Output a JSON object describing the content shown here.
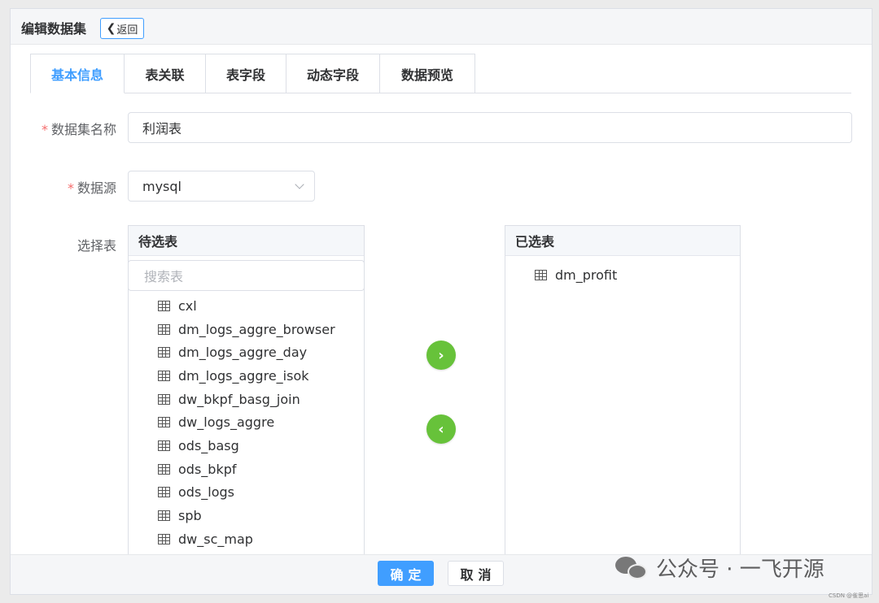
{
  "header": {
    "title": "编辑数据集",
    "back_label": "返回"
  },
  "tabs": [
    {
      "label": "基本信息",
      "active": true
    },
    {
      "label": "表关联"
    },
    {
      "label": "表字段"
    },
    {
      "label": "动态字段"
    },
    {
      "label": "数据预览"
    }
  ],
  "form": {
    "name_label": "数据集名称",
    "name_value": "利润表",
    "source_label": "数据源",
    "source_value": "mysql",
    "select_label": "选择表",
    "required_mark": "*"
  },
  "candidate_panel": {
    "title": "待选表",
    "search_placeholder": "搜索表",
    "items": [
      "cxl",
      "dm_logs_aggre_browser",
      "dm_logs_aggre_day",
      "dm_logs_aggre_isok",
      "dw_bkpf_basg_join",
      "dw_logs_aggre",
      "ods_basg",
      "ods_bkpf",
      "ods_logs",
      "spb",
      "dw_sc_map"
    ]
  },
  "selected_panel": {
    "title": "已选表",
    "items": [
      "dm_profit"
    ]
  },
  "transfer": {
    "to_right_glyph": "›",
    "to_left_glyph": "‹"
  },
  "footer": {
    "confirm_label": "确定",
    "cancel_label": "取消"
  },
  "watermark": {
    "text": "公众号 · 一飞开源",
    "small": "CSDN @雀思ai"
  },
  "colors": {
    "primary": "#409eff",
    "success": "#67c23a",
    "required": "#f56c6c"
  },
  "icons": {
    "back": "chevron-left-icon",
    "table": "table-icon",
    "select_arrow": "chevron-down-icon"
  }
}
